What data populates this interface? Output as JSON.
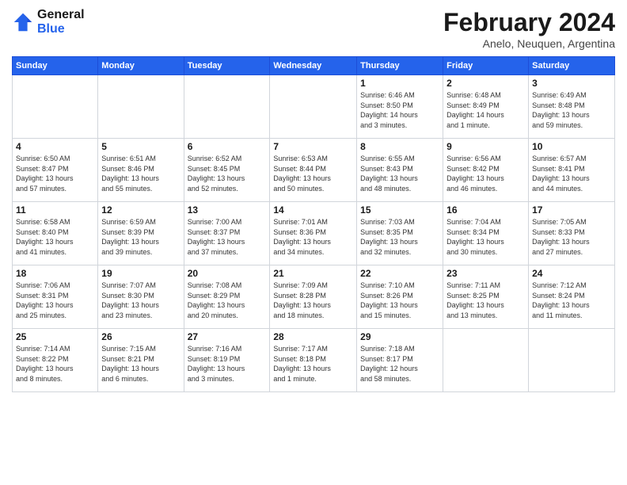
{
  "logo": {
    "line1": "General",
    "line2": "Blue"
  },
  "title": "February 2024",
  "location": "Anelo, Neuquen, Argentina",
  "weekdays": [
    "Sunday",
    "Monday",
    "Tuesday",
    "Wednesday",
    "Thursday",
    "Friday",
    "Saturday"
  ],
  "weeks": [
    [
      {
        "date": "",
        "info": ""
      },
      {
        "date": "",
        "info": ""
      },
      {
        "date": "",
        "info": ""
      },
      {
        "date": "",
        "info": ""
      },
      {
        "date": "1",
        "info": "Sunrise: 6:46 AM\nSunset: 8:50 PM\nDaylight: 14 hours\nand 3 minutes."
      },
      {
        "date": "2",
        "info": "Sunrise: 6:48 AM\nSunset: 8:49 PM\nDaylight: 14 hours\nand 1 minute."
      },
      {
        "date": "3",
        "info": "Sunrise: 6:49 AM\nSunset: 8:48 PM\nDaylight: 13 hours\nand 59 minutes."
      }
    ],
    [
      {
        "date": "4",
        "info": "Sunrise: 6:50 AM\nSunset: 8:47 PM\nDaylight: 13 hours\nand 57 minutes."
      },
      {
        "date": "5",
        "info": "Sunrise: 6:51 AM\nSunset: 8:46 PM\nDaylight: 13 hours\nand 55 minutes."
      },
      {
        "date": "6",
        "info": "Sunrise: 6:52 AM\nSunset: 8:45 PM\nDaylight: 13 hours\nand 52 minutes."
      },
      {
        "date": "7",
        "info": "Sunrise: 6:53 AM\nSunset: 8:44 PM\nDaylight: 13 hours\nand 50 minutes."
      },
      {
        "date": "8",
        "info": "Sunrise: 6:55 AM\nSunset: 8:43 PM\nDaylight: 13 hours\nand 48 minutes."
      },
      {
        "date": "9",
        "info": "Sunrise: 6:56 AM\nSunset: 8:42 PM\nDaylight: 13 hours\nand 46 minutes."
      },
      {
        "date": "10",
        "info": "Sunrise: 6:57 AM\nSunset: 8:41 PM\nDaylight: 13 hours\nand 44 minutes."
      }
    ],
    [
      {
        "date": "11",
        "info": "Sunrise: 6:58 AM\nSunset: 8:40 PM\nDaylight: 13 hours\nand 41 minutes."
      },
      {
        "date": "12",
        "info": "Sunrise: 6:59 AM\nSunset: 8:39 PM\nDaylight: 13 hours\nand 39 minutes."
      },
      {
        "date": "13",
        "info": "Sunrise: 7:00 AM\nSunset: 8:37 PM\nDaylight: 13 hours\nand 37 minutes."
      },
      {
        "date": "14",
        "info": "Sunrise: 7:01 AM\nSunset: 8:36 PM\nDaylight: 13 hours\nand 34 minutes."
      },
      {
        "date": "15",
        "info": "Sunrise: 7:03 AM\nSunset: 8:35 PM\nDaylight: 13 hours\nand 32 minutes."
      },
      {
        "date": "16",
        "info": "Sunrise: 7:04 AM\nSunset: 8:34 PM\nDaylight: 13 hours\nand 30 minutes."
      },
      {
        "date": "17",
        "info": "Sunrise: 7:05 AM\nSunset: 8:33 PM\nDaylight: 13 hours\nand 27 minutes."
      }
    ],
    [
      {
        "date": "18",
        "info": "Sunrise: 7:06 AM\nSunset: 8:31 PM\nDaylight: 13 hours\nand 25 minutes."
      },
      {
        "date": "19",
        "info": "Sunrise: 7:07 AM\nSunset: 8:30 PM\nDaylight: 13 hours\nand 23 minutes."
      },
      {
        "date": "20",
        "info": "Sunrise: 7:08 AM\nSunset: 8:29 PM\nDaylight: 13 hours\nand 20 minutes."
      },
      {
        "date": "21",
        "info": "Sunrise: 7:09 AM\nSunset: 8:28 PM\nDaylight: 13 hours\nand 18 minutes."
      },
      {
        "date": "22",
        "info": "Sunrise: 7:10 AM\nSunset: 8:26 PM\nDaylight: 13 hours\nand 15 minutes."
      },
      {
        "date": "23",
        "info": "Sunrise: 7:11 AM\nSunset: 8:25 PM\nDaylight: 13 hours\nand 13 minutes."
      },
      {
        "date": "24",
        "info": "Sunrise: 7:12 AM\nSunset: 8:24 PM\nDaylight: 13 hours\nand 11 minutes."
      }
    ],
    [
      {
        "date": "25",
        "info": "Sunrise: 7:14 AM\nSunset: 8:22 PM\nDaylight: 13 hours\nand 8 minutes."
      },
      {
        "date": "26",
        "info": "Sunrise: 7:15 AM\nSunset: 8:21 PM\nDaylight: 13 hours\nand 6 minutes."
      },
      {
        "date": "27",
        "info": "Sunrise: 7:16 AM\nSunset: 8:19 PM\nDaylight: 13 hours\nand 3 minutes."
      },
      {
        "date": "28",
        "info": "Sunrise: 7:17 AM\nSunset: 8:18 PM\nDaylight: 13 hours\nand 1 minute."
      },
      {
        "date": "29",
        "info": "Sunrise: 7:18 AM\nSunset: 8:17 PM\nDaylight: 12 hours\nand 58 minutes."
      },
      {
        "date": "",
        "info": ""
      },
      {
        "date": "",
        "info": ""
      }
    ]
  ]
}
